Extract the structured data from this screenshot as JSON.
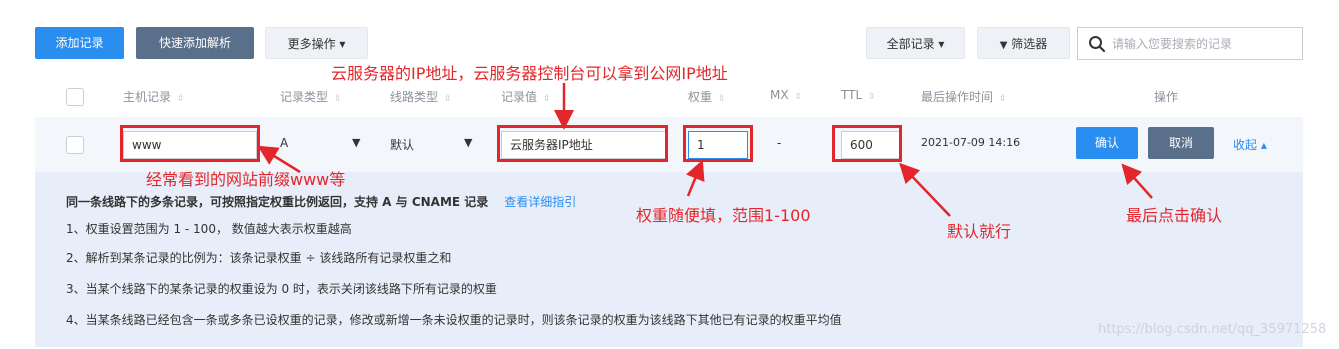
{
  "toolbar": {
    "add_record": "添加记录",
    "quick_add": "快速添加解析",
    "more_ops": "更多操作 ▾",
    "all_records": "全部记录 ▾",
    "filter": "筛选器",
    "search_placeholder": "请输入您要搜索的记录"
  },
  "table": {
    "headers": {
      "host": "主机记录",
      "type": "记录类型",
      "line": "线路类型",
      "value": "记录值",
      "weight": "权重",
      "mx": "MX",
      "ttl": "TTL",
      "last_op": "最后操作时间",
      "ops": "操作"
    },
    "row": {
      "host": "www",
      "type": "A",
      "line": "默认",
      "value": "云服务器IP地址",
      "weight": "1",
      "mx": "-",
      "ttl": "600",
      "last_op": "2021-07-09 14:16",
      "confirm": "确认",
      "cancel": "取消",
      "collapse": "收起 ▴"
    }
  },
  "info": {
    "title": "同一条线路下的多条记录，可按照指定权重比例返回，支持 A 与 CNAME 记录",
    "link": "查看详细指引",
    "lines": [
      "1、权重设置范围为 1 - 100， 数值越大表示权重越高",
      "2、解析到某条记录的比例为：该条记录权重 ÷ 该线路所有记录权重之和",
      "3、当某个线路下的某条记录的权重设为 0 时，表示关闭该线路下所有记录的权重",
      "4、当某条线路已经包含一条或多条已设权重的记录，修改或新增一条未设权重的记录时，则该条记录的权重为该线路下其他已有记录的权重平均值"
    ]
  },
  "annotations": {
    "ip": "云服务器的IP地址，云服务器控制台可以拿到公网IP地址",
    "prefix": "经常看到的网站前缀www等",
    "weight": "权重随便填，范围1-100",
    "ttl": "默认就行",
    "confirm": "最后点击确认"
  },
  "watermark": "https://blog.csdn.net/qq_35971258",
  "colors": {
    "primary": "#2a8df0",
    "annotation": "#e3262b",
    "info_bg": "#e8eef9"
  }
}
